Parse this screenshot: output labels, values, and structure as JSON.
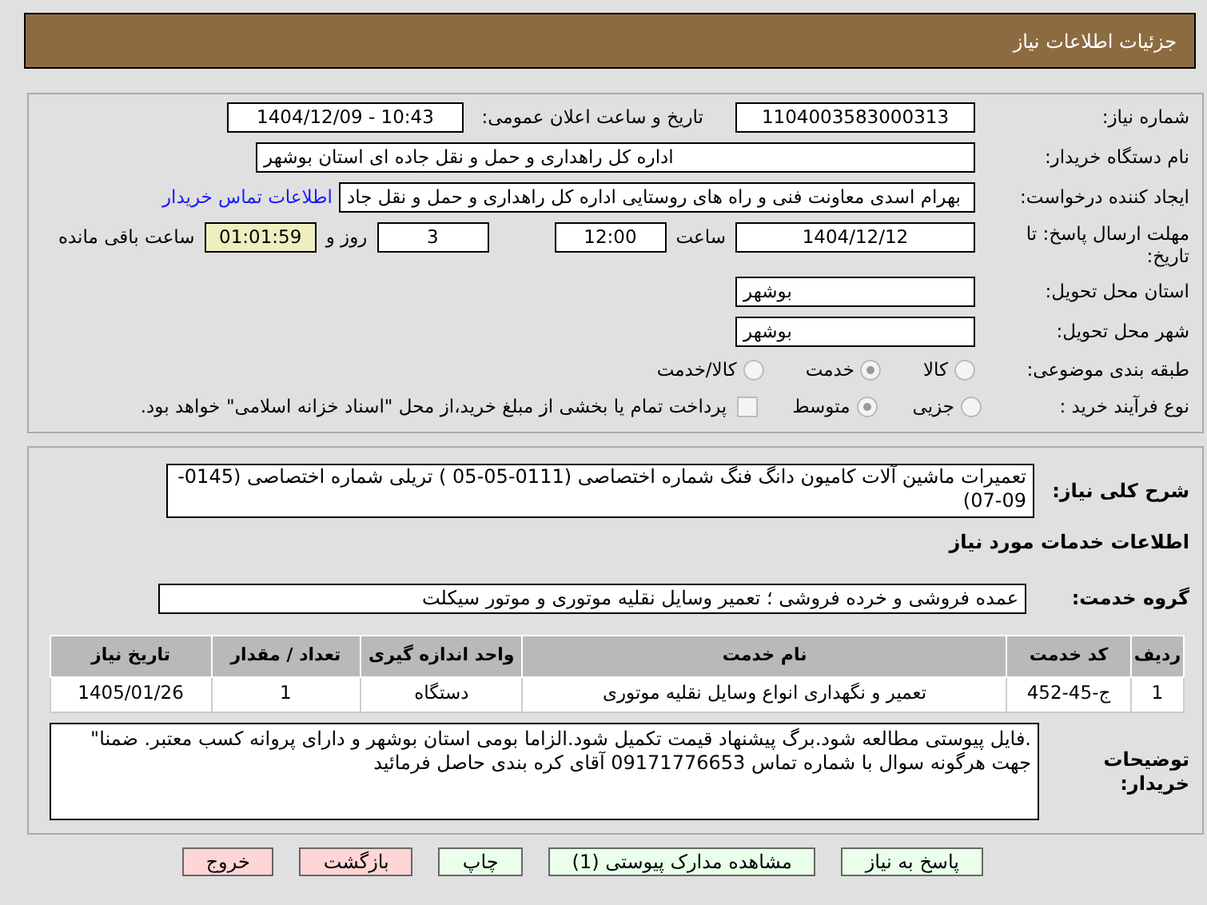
{
  "header": {
    "title": "جزئیات اطلاعات نیاز"
  },
  "need_number": {
    "label": "شماره نیاز:",
    "value": "1104003583000313"
  },
  "announce": {
    "label": "تاریخ و ساعت اعلان عمومی:",
    "value": "1404/12/09 - 10:43"
  },
  "buyer_org": {
    "label": "نام دستگاه خریدار:",
    "value": "اداره کل راهداری و حمل و نقل جاده ای استان بوشهر"
  },
  "requester": {
    "label": "ایجاد کننده درخواست:",
    "value": "بهرام اسدی معاونت فنی و راه های روستایی اداره کل راهداری و حمل و نقل جاد",
    "link": "اطلاعات تماس خریدار"
  },
  "deadline": {
    "label": "مهلت ارسال پاسخ: تا تاریخ:",
    "date": "1404/12/12",
    "time_label": "ساعت",
    "time": "12:00",
    "days": "3",
    "days_label": "روز و",
    "remaining": "01:01:59",
    "remaining_label": "ساعت باقی مانده"
  },
  "province": {
    "label": "استان محل تحویل:",
    "value": "بوشهر"
  },
  "city": {
    "label": "شهر محل تحویل:",
    "value": "بوشهر"
  },
  "category": {
    "label": "طبقه بندی موضوعی:",
    "options": [
      {
        "label": "کالا",
        "selected": false
      },
      {
        "label": "خدمت",
        "selected": true
      },
      {
        "label": "کالا/خدمت",
        "selected": false
      }
    ]
  },
  "process": {
    "label": "نوع فرآیند خرید :",
    "options": [
      {
        "label": "جزیی",
        "selected": false
      },
      {
        "label": "متوسط",
        "selected": true
      }
    ],
    "checkbox": {
      "label": "پرداخت تمام یا بخشی از مبلغ خرید،از محل \"اسناد خزانه اسلامی\" خواهد بود.",
      "checked": false
    }
  },
  "description": {
    "label": "شرح کلی نیاز:",
    "value": "تعمیرات ماشین آلات کامیون دانگ فنگ شماره اختصاصی (0111-05-05 ) تریلی شماره اختصاصی (0145-09-07)"
  },
  "services_heading": "اطلاعات خدمات مورد نیاز",
  "service_group": {
    "label": "گروه خدمت:",
    "value": "عمده فروشی و خرده فروشی ؛ تعمیر وسایل نقلیه موتوری و موتور سیکلت"
  },
  "table": {
    "columns": [
      "ردیف",
      "کد خدمت",
      "نام خدمت",
      "واحد اندازه گیری",
      "تعداد / مقدار",
      "تاریخ نیاز"
    ],
    "rows": [
      [
        "1",
        "ج-45-452",
        "تعمیر و نگهداری انواع وسایل نقلیه موتوری",
        "دستگاه",
        "1",
        "1405/01/26"
      ]
    ]
  },
  "buyer_notes": {
    "label": "توضیحات خریدار:",
    "value": ".فایل پیوستی مطالعه شود.برگ پیشنهاد قیمت تکمیل شود.الزاما بومی استان بوشهر و دارای پروانه کسب معتبر. ضمنا\" جهت هرگونه سوال با شماره تماس 09171776653 آقای کره بندی حاصل فرمائید"
  },
  "buttons": [
    {
      "label": "پاسخ به نیاز",
      "kind": "primary"
    },
    {
      "label": "مشاهده مدارک پیوستی (1)",
      "kind": "primary"
    },
    {
      "label": "چاپ",
      "kind": "primary"
    },
    {
      "label": "بازگشت",
      "kind": "danger"
    },
    {
      "label": "خروج",
      "kind": "danger"
    }
  ]
}
